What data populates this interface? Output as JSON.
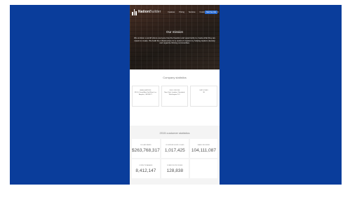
{
  "nav": {
    "logo_text_bold": "Nation",
    "logo_text_thin": "Builder",
    "links": [
      "Features",
      "Pricing",
      "Services",
      "Customers",
      "Support"
    ],
    "cta_label": "Start free trial",
    "topbar_text": ""
  },
  "hero": {
    "title": "Our mission",
    "body": "We envision a world where everyone has the freedom and opportunity to create what they are meant to create. We build the infrastructure for a world of creators by helping leaders develop and organize thriving communities."
  },
  "company": {
    "title": "Company statistics",
    "cards": [
      {
        "label": "Headquarters",
        "value": "520 S. Grand Ave 2nd Floor Los Angeles, CA 90071"
      },
      {
        "label": "Field offices",
        "value": "New York, London, Cleveland, Washington D.C."
      },
      {
        "label": "Employees",
        "value": "90"
      }
    ]
  },
  "stats": {
    "title": "2015 customer statistics",
    "cells": [
      {
        "label": "Dollars raised",
        "value": "$263,768,317"
      },
      {
        "label": "Volunteer hours logged",
        "value": "1,017,425"
      },
      {
        "label": "Emails delivered",
        "value": "104,111,087"
      },
      {
        "label": "Contacts managed",
        "value": "8,412,147"
      },
      {
        "label": "Donations processed",
        "value": "128,838"
      },
      {
        "label": "",
        "value": ""
      }
    ]
  }
}
